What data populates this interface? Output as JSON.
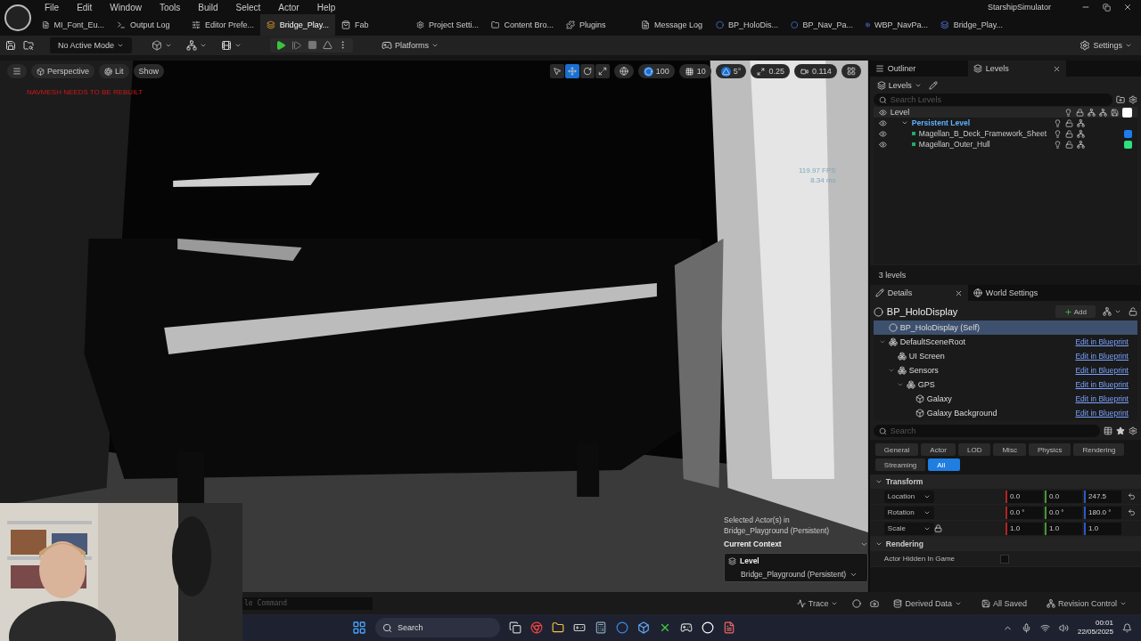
{
  "window": {
    "title": "StarshipSimulator"
  },
  "menu": [
    "File",
    "Edit",
    "Window",
    "Tools",
    "Build",
    "Select",
    "Actor",
    "Help"
  ],
  "tabs": [
    {
      "label": "MI_Font_Eu...",
      "selected": false
    },
    {
      "label": "Output Log",
      "selected": false
    },
    {
      "label": "Editor Prefe...",
      "selected": false
    },
    {
      "label": "Bridge_Play...",
      "selected": true
    },
    {
      "label": "Fab",
      "selected": false
    },
    {
      "label": "Project Setti...",
      "selected": false
    },
    {
      "label": "Content Bro...",
      "selected": false
    },
    {
      "label": "Plugins",
      "selected": false
    },
    {
      "label": "Message Log",
      "selected": false
    },
    {
      "label": "BP_HoloDis...",
      "selected": false
    },
    {
      "label": "BP_Nav_Pa...",
      "selected": false
    },
    {
      "label": "WBP_NavPa...",
      "selected": false
    },
    {
      "label": "Bridge_Play...",
      "selected": false
    }
  ],
  "toolbar": {
    "mode": "No Active Mode",
    "platforms": "Platforms",
    "settings": "Settings"
  },
  "viewport": {
    "buttons": [
      "Perspective",
      "Lit",
      "Show"
    ],
    "tools": [
      {
        "kind": "select",
        "selected": false
      },
      {
        "kind": "move",
        "selected": true
      },
      {
        "kind": "rotate",
        "selected": false
      },
      {
        "kind": "scale",
        "selected": false
      }
    ],
    "snaps": [
      {
        "kind": "surface",
        "value": "100",
        "on": true
      },
      {
        "kind": "grid",
        "value": "10",
        "on": false
      },
      {
        "kind": "angle",
        "value": "5°",
        "on": true
      },
      {
        "kind": "scale",
        "value": "0.25",
        "on": false
      },
      {
        "kind": "camera",
        "value": "0.114",
        "on": false
      }
    ],
    "warning": "NAVMESH NEEDS TO BE REBUILT",
    "fps": "119.97 FPS",
    "frame_time": "8.34 ms",
    "selection_info": "Selected Actor(s) in",
    "selection_level": "Bridge_Playground (Persistent)",
    "context_title": "Current Context",
    "context_level_label": "Level",
    "context_level": "Bridge_Playground (Persistent)"
  },
  "outliner": {
    "tabs": [
      {
        "label": "Outliner",
        "selected": false
      },
      {
        "label": "Levels",
        "selected": true
      }
    ],
    "levels_menu": "Levels",
    "search_placeholder": "Search Levels",
    "header": "Level",
    "levels": [
      {
        "name": "Persistent Level",
        "expanded": true,
        "children": [
          {
            "name": "Magellan_B_Deck_Framework_Sheet",
            "color": "#1e7cf2"
          },
          {
            "name": "Magellan_Outer_Hull",
            "color": "#2ee07e"
          }
        ]
      }
    ],
    "footer": "3 levels"
  },
  "details": {
    "tabs": [
      {
        "label": "Details",
        "selected": true
      },
      {
        "label": "World Settings",
        "selected": false
      }
    ],
    "actor": "BP_HoloDisplay",
    "add": "Add",
    "components": [
      {
        "name": "BP_HoloDisplay (Self)",
        "selected": true
      },
      {
        "name": "DefaultSceneRoot",
        "selected": false,
        "link": "Edit in Blueprint",
        "expanded": true,
        "children": [
          {
            "name": "UI Screen",
            "selected": false,
            "link": "Edit in Blueprint"
          },
          {
            "name": "Sensors",
            "selected": false,
            "link": "Edit in Blueprint",
            "expanded": true,
            "children": [
              {
                "name": "GPS",
                "selected": false,
                "link": "Edit in Blueprint",
                "expanded": true,
                "children": [
                  {
                    "name": "Galaxy",
                    "selected": false,
                    "link": "Edit in Blueprint"
                  },
                  {
                    "name": "Galaxy Background",
                    "selected": false,
                    "link": "Edit in Blueprint"
                  }
                ]
              }
            ]
          }
        ]
      }
    ],
    "search_placeholder": "Search",
    "filters": [
      {
        "label": "General",
        "selected": false
      },
      {
        "label": "Actor",
        "selected": false
      },
      {
        "label": "LOD",
        "selected": false
      },
      {
        "label": "Misc",
        "selected": false
      },
      {
        "label": "Physics",
        "selected": false
      },
      {
        "label": "Rendering",
        "selected": false
      },
      {
        "label": "Streaming",
        "selected": false
      },
      {
        "label": "All",
        "selected": true
      }
    ],
    "sections": [
      {
        "title": "Transform",
        "expanded": true,
        "rows": [
          {
            "kind": "vector",
            "label": "Location",
            "values": [
              "0.0",
              "0.0",
              "247.5"
            ],
            "locked": false,
            "reset": true
          },
          {
            "kind": "vector",
            "label": "Rotation",
            "values": [
              "0.0 °",
              "0.0 °",
              "180.0 °"
            ],
            "locked": false,
            "reset": true
          },
          {
            "kind": "vector",
            "label": "Scale",
            "values": [
              "1.0",
              "1.0",
              "1.0"
            ],
            "locked": true,
            "reset": false
          }
        ]
      },
      {
        "title": "Rendering",
        "expanded": true,
        "rows": [
          {
            "kind": "checkbox",
            "label": "Actor Hidden In Game",
            "checked": false
          }
        ]
      }
    ]
  },
  "status_bar": {
    "console_placeholder": "le Command",
    "trace": "Trace",
    "derived_data": "Derived Data",
    "saved": "All Saved",
    "revision": "Revision Control"
  },
  "taskbar": {
    "search": "Search",
    "time": "00:01",
    "date": "22/05/2025"
  }
}
